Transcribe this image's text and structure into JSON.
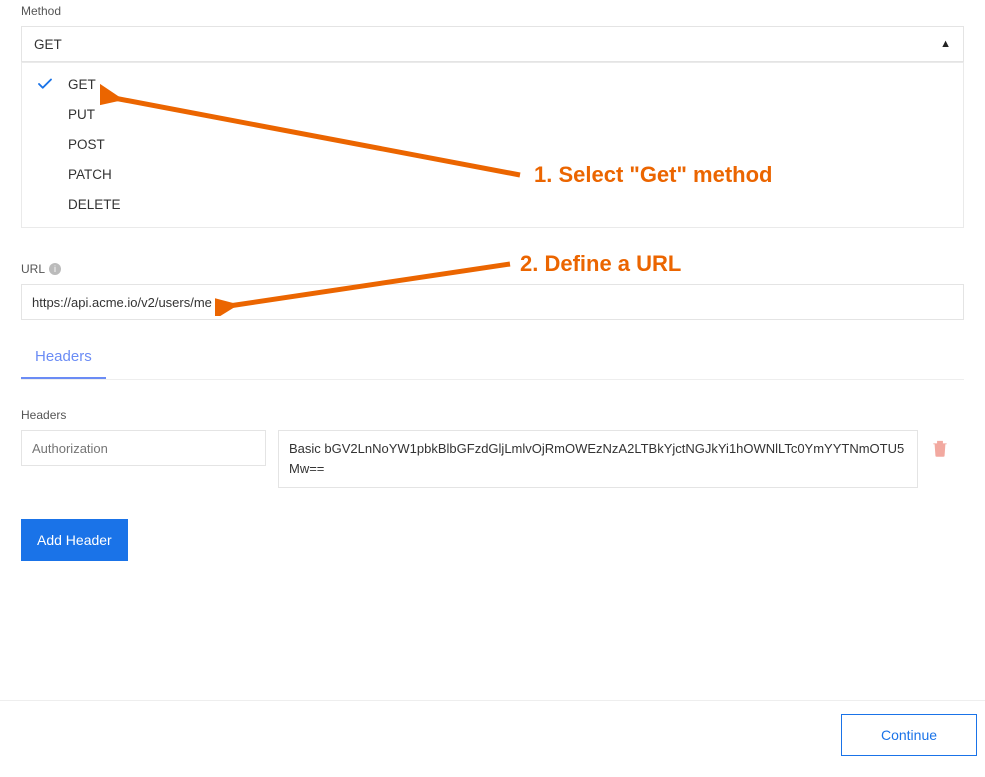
{
  "method": {
    "label": "Method",
    "selected": "GET",
    "options": [
      "GET",
      "PUT",
      "POST",
      "PATCH",
      "DELETE"
    ]
  },
  "url": {
    "label": "URL",
    "value": "https://api.acme.io/v2/users/me"
  },
  "tabs": [
    {
      "label": "Headers",
      "active": true
    }
  ],
  "headers": {
    "label": "Headers",
    "rows": [
      {
        "key_placeholder": "Authorization",
        "value": "Basic bGV2LnNoYW1pbkBlbGFzdGljLmlvOjRmOWEzNzA2LTBkYjctNGJkYi1hOWNlLTc0YmYYTNmOTU5Mw=="
      }
    ]
  },
  "buttons": {
    "add_header": "Add Header",
    "continue": "Continue"
  },
  "annotations": {
    "step1": "1. Select \"Get\" method",
    "step2": "2. Define a URL"
  }
}
